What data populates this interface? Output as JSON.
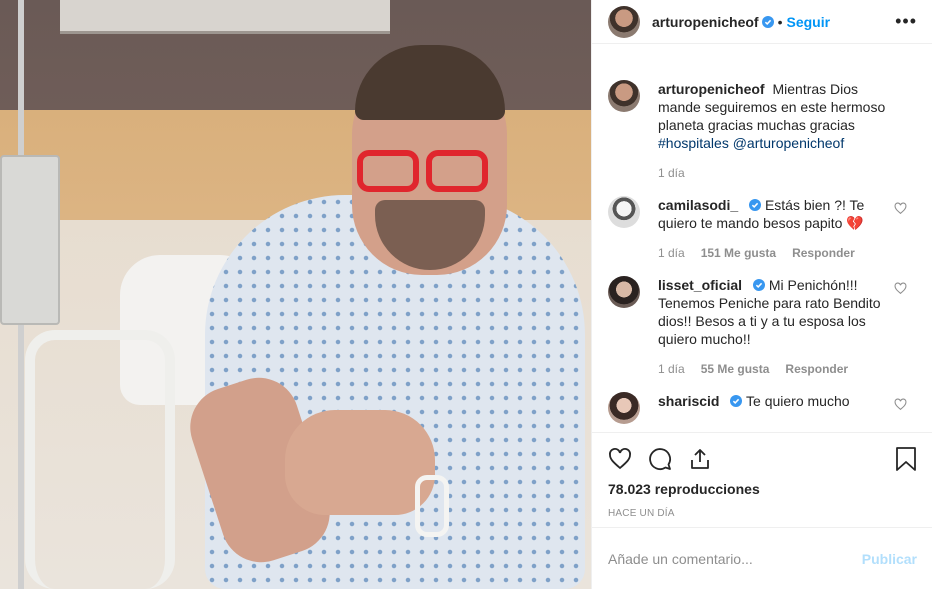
{
  "header": {
    "username": "arturopenicheof",
    "separator": "•",
    "follow_label": "Seguir",
    "more_label": "•••"
  },
  "caption": {
    "username": "arturopenicheof",
    "text": "Mientras Dios mande seguiremos en este hermoso planeta gracias muchas gracias",
    "hashtag": "#hospitales",
    "mention": "@arturopenicheof",
    "time": "1 día"
  },
  "comments": [
    {
      "username": "camilasodi_",
      "text": "Estás bien ?! Te quiero te mando besos papito 💔",
      "time": "1 día",
      "likes": "151 Me gusta",
      "reply": "Responder"
    },
    {
      "username": "lisset_oficial",
      "text": "Mi Penichón!!! Tenemos Peniche para rato Bendito dios!! Besos a ti y a tu esposa los quiero mucho!!",
      "time": "1 día",
      "likes": "55 Me gusta",
      "reply": "Responder"
    },
    {
      "username": "shariscid",
      "text": "Te quiero mucho",
      "time": "",
      "likes": "",
      "reply": ""
    }
  ],
  "stats": {
    "views": "78.023 reproducciones",
    "posted": "HACE UN DÍA"
  },
  "add_comment": {
    "placeholder": "Añade un comentario...",
    "publish_label": "Publicar"
  },
  "colors": {
    "accent": "#0095f6",
    "publish_disabled": "#b2dffc",
    "muted": "#8e8e8e",
    "text": "#262626"
  },
  "icons": [
    "verified-icon",
    "more-icon",
    "heart-icon",
    "comment-icon",
    "share-icon",
    "bookmark-icon"
  ]
}
